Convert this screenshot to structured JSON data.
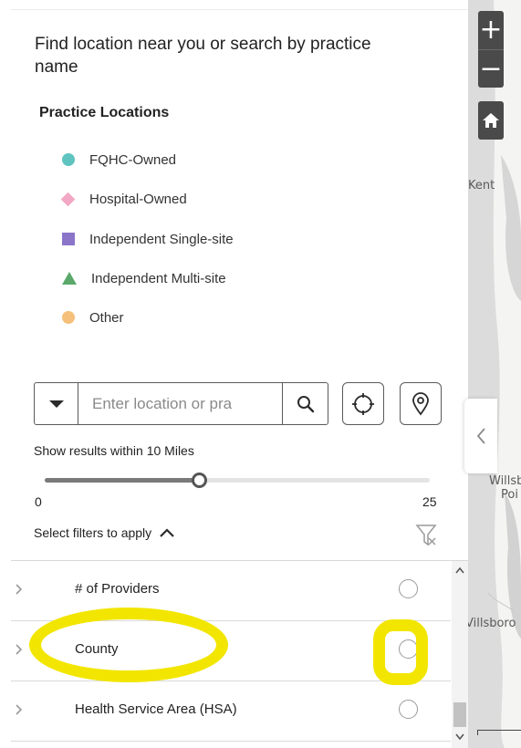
{
  "panel": {
    "instructions": "Find location near you or search by practice name",
    "legend": {
      "title": "Practice Locations",
      "items": [
        {
          "label": "FQHC-Owned",
          "shape": "circle",
          "color": "#5fc4bf"
        },
        {
          "label": "Hospital-Owned",
          "shape": "diamond",
          "color": "#f2a8c4"
        },
        {
          "label": "Independent Single-site",
          "shape": "square",
          "color": "#8a75c9"
        },
        {
          "label": "Independent Multi-site",
          "shape": "triangle",
          "color": "#5aa86a"
        },
        {
          "label": "Other",
          "shape": "circle",
          "color": "#f5c07a"
        }
      ]
    },
    "search": {
      "placeholder": "Enter location or pra",
      "value": "",
      "icons": {
        "dropdown": "caret-down-icon",
        "search": "search-icon",
        "locate": "crosshair-icon",
        "pin": "location-pin-icon"
      }
    },
    "radius": {
      "label": "Show results within 10 Miles",
      "value": 10,
      "min": 0,
      "max": 25,
      "min_label": "0",
      "max_label": "25"
    },
    "filters": {
      "label": "Select filters to apply",
      "rows": [
        {
          "label": "# of Providers",
          "selected": false
        },
        {
          "label": "County",
          "selected": false
        },
        {
          "label": "Health Service Area (HSA)",
          "selected": false
        }
      ]
    }
  },
  "map": {
    "zoom_in": "+",
    "zoom_out": "−",
    "labels": {
      "kent": "Kent",
      "willsb": "Willsb",
      "poi": "Poi",
      "villsboro": "Villsboro"
    }
  },
  "colors": {
    "highlight": "#f2e600",
    "map_control": "#4a4a4a"
  }
}
